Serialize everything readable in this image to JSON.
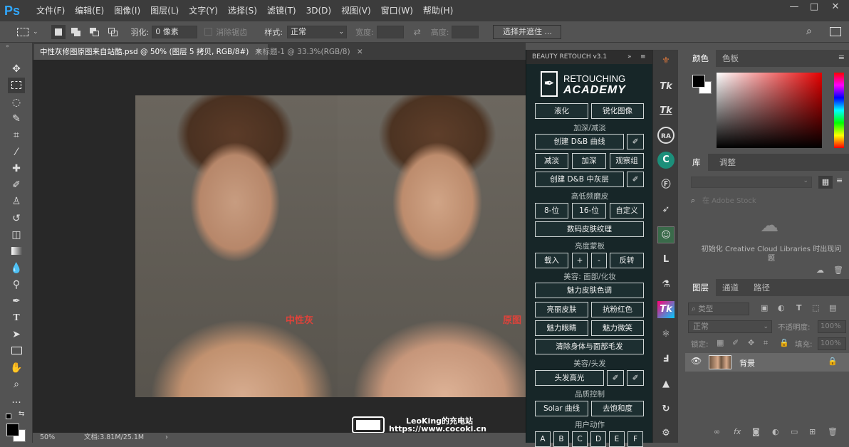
{
  "app": {
    "logo": "Ps"
  },
  "menu": [
    "文件(F)",
    "编辑(E)",
    "图像(I)",
    "图层(L)",
    "文字(Y)",
    "选择(S)",
    "滤镜(T)",
    "3D(D)",
    "视图(V)",
    "窗口(W)",
    "帮助(H)"
  ],
  "options": {
    "feather_label": "羽化:",
    "feather_value": "0 像素",
    "antialias_label": "消除锯齿",
    "style_label": "样式:",
    "style_value": "正常",
    "width_label": "宽度:",
    "height_label": "高度:",
    "select_mask_button": "选择并遮住 ..."
  },
  "doc_tabs": [
    {
      "label": "中性灰修图原图来自站酷.psd @ 50% (图层 5 拷贝, RGB/8#)",
      "active": true
    },
    {
      "label": "未标题-1 @ 33.3%(RGB/8)",
      "active": false
    }
  ],
  "canvas": {
    "left_label": "中性灰",
    "right_label": "原图"
  },
  "status": {
    "zoom": "50%",
    "doc_info": "文档:3.81M/25.1M"
  },
  "watermark": {
    "line1": "LeoKing的充电站",
    "line2": "https://www.cocokl.cn"
  },
  "panel": {
    "title": "BEAUTY RETOUCH v3.1",
    "brand_top": "RETOUCHING",
    "brand_bottom": "ACADEMY",
    "btn_liquify": "液化",
    "btn_sharpen": "锐化图像",
    "sec_dodge_burn": "加深/减淡",
    "btn_db_curves": "创建 D&B 曲线",
    "btn_dodge": "减淡",
    "btn_burn": "加深",
    "btn_observe": "观察组",
    "btn_db_gray": "创建 D&B 中灰层",
    "sec_freq": "高低频磨皮",
    "btn_8bit": "8-位",
    "btn_16bit": "16-位",
    "btn_custom": "自定义",
    "btn_skin_texture": "数码皮肤纹理",
    "sec_lum": "亮度蒙板",
    "btn_load": "载入",
    "btn_plus": "+",
    "btn_minus": "-",
    "btn_invert": "反转",
    "sec_beauty_face": "美容: 面部/化妆",
    "btn_skin_tone": "魅力皮肤色调",
    "btn_bright_skin": "亮丽皮肤",
    "btn_anti_red": "抗粉红色",
    "btn_eyes": "魅力眼睛",
    "btn_smile": "魅力微笑",
    "btn_remove_hair": "清除身体与面部毛发",
    "sec_hair": "美容/头发",
    "btn_hair_highlight": "头发高光",
    "sec_quality": "品质控制",
    "btn_solar": "Solar 曲线",
    "btn_desat": "去饱和度",
    "sec_user": "用户动作",
    "user_actions": [
      "A",
      "B",
      "C",
      "D",
      "E",
      "F"
    ]
  },
  "right": {
    "color_tabs": [
      "颜色",
      "色板"
    ],
    "lib_tabs": [
      "库",
      "调整"
    ],
    "lib_search_placeholder": "在 Adobe Stock",
    "lib_message": "初始化 Creative Cloud Libraries 时出现问题",
    "layer_tabs": [
      "图层",
      "通道",
      "路径"
    ],
    "filter_kind": "类型",
    "blend_mode": "正常",
    "opacity_label": "不透明度:",
    "opacity_value": "100%",
    "lock_label": "锁定:",
    "fill_label": "填充:",
    "fill_value": "100%",
    "layer_name": "背景"
  },
  "colors": {
    "accent": "#31a8ff",
    "panel_bg": "#172628",
    "label_red": "#e0423a"
  }
}
